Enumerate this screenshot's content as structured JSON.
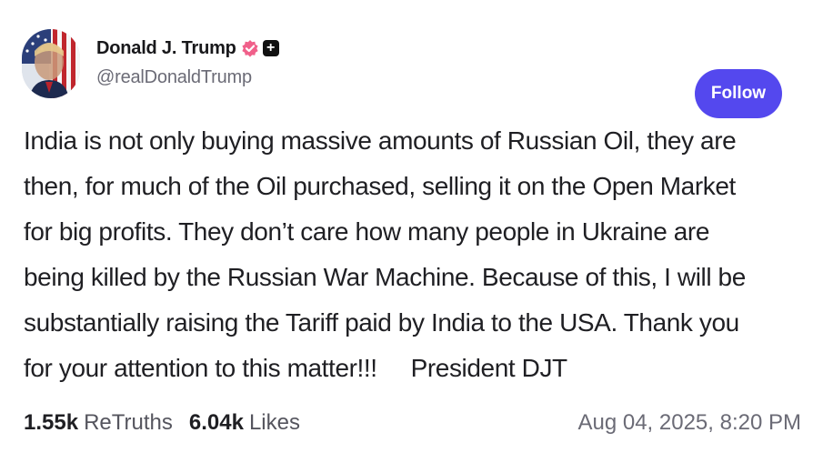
{
  "author": {
    "display_name": "Donald J. Trump",
    "handle": "@realDonaldTrump",
    "avatar_icon": "flag-portrait-avatar",
    "verified_icon": "verified-badge-icon",
    "plus_icon": "plus-badge-icon",
    "plus_symbol": "+"
  },
  "follow_button": {
    "label": "Follow"
  },
  "post": {
    "text": "India is not only buying massive amounts of Russian Oil, they are\nthen, for much of the Oil purchased, selling it on the Open Market\nfor big profits. They don’t care how many people in Ukraine are\nbeing killed by the Russian War Machine. Because of this, I will be\nsubstantially raising the Tariff paid by India to the USA. Thank you\nfor your attention to this matter!!!     President DJT"
  },
  "stats": {
    "retruths_count": "1.55k",
    "retruths_label": "ReTruths",
    "likes_count": "6.04k",
    "likes_label": "Likes"
  },
  "timestamp": "Aug 04, 2025, 8:20 PM",
  "colors": {
    "accent": "#5448ee",
    "verified": "#f0608a",
    "text": "#1f1f23",
    "muted": "#6b6b76"
  }
}
